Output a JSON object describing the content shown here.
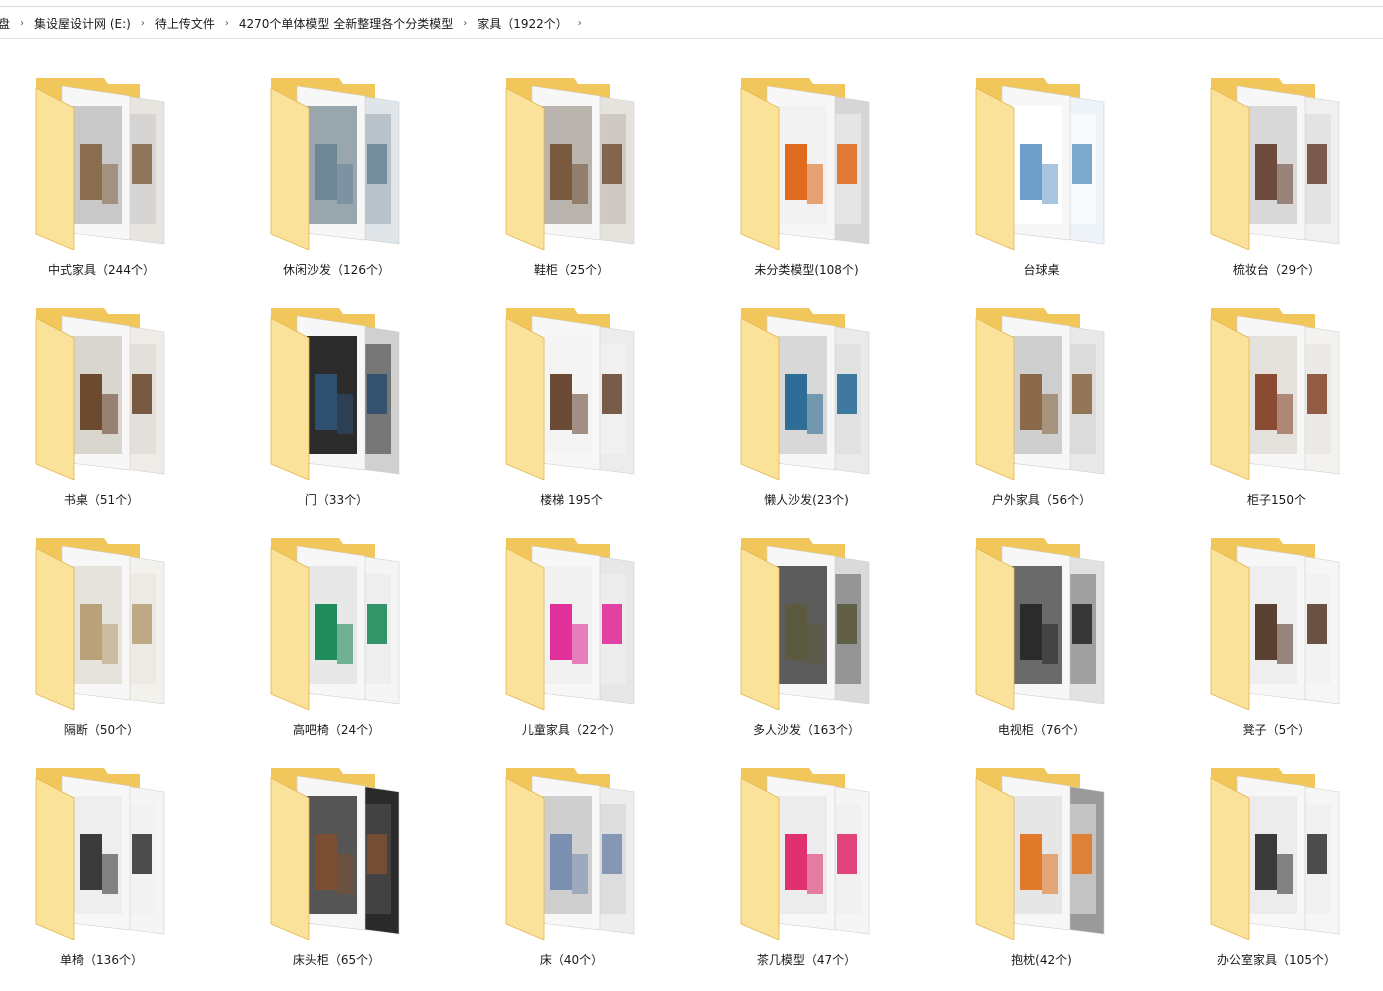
{
  "breadcrumb": [
    "盘",
    "集设屋设计网 (E:)",
    "待上传文件",
    "4270个单体模型 全新整理各个分类模型",
    "家具（1922个）"
  ],
  "folders": [
    {
      "label": "中式家具（244个）",
      "icon": "folder-icon",
      "theme": [
        "#c9c9c9",
        "#8a6c4e",
        "#e8e4df"
      ]
    },
    {
      "label": "休闲沙发（126个）",
      "icon": "folder-icon",
      "theme": [
        "#9aa6ae",
        "#6d8797",
        "#dfe5e8"
      ]
    },
    {
      "label": "鞋柜（25个）",
      "icon": "folder-icon",
      "theme": [
        "#b9b5ae",
        "#7a5a3f",
        "#e6e3de"
      ]
    },
    {
      "label": "未分类模型(108个)",
      "icon": "folder-icon",
      "theme": [
        "#f2f2f2",
        "#e06b1f",
        "#d6d6d6"
      ]
    },
    {
      "label": "台球桌",
      "icon": "folder-icon",
      "theme": [
        "#ffffff",
        "#6f9ec9",
        "#eef3f8"
      ]
    },
    {
      "label": "梳妆台（29个）",
      "icon": "folder-icon",
      "theme": [
        "#d8d8d8",
        "#6e4a3c",
        "#f0f0f0"
      ]
    },
    {
      "label": "书桌（51个）",
      "icon": "folder-icon",
      "theme": [
        "#d9d5cf",
        "#6b4a30",
        "#efece8"
      ]
    },
    {
      "label": "门（33个）",
      "icon": "folder-icon",
      "theme": [
        "#2b2b2b",
        "#2f4f6e",
        "#d0d0d0"
      ]
    },
    {
      "label": "楼梯 195个",
      "icon": "folder-icon",
      "theme": [
        "#f4f4f4",
        "#6b4a36",
        "#ececec"
      ]
    },
    {
      "label": "懒人沙发(23个)",
      "icon": "folder-icon",
      "theme": [
        "#d8d8d8",
        "#2e6e96",
        "#eaeaea"
      ]
    },
    {
      "label": "户外家具（56个）",
      "icon": "folder-icon",
      "theme": [
        "#cfcfcf",
        "#8a6a48",
        "#e9e9e9"
      ]
    },
    {
      "label": "柜子150个",
      "icon": "folder-icon",
      "theme": [
        "#e4e1dc",
        "#8a4b32",
        "#f4f2ef"
      ]
    },
    {
      "label": "隔断（50个）",
      "icon": "folder-icon",
      "theme": [
        "#e6e3dd",
        "#b9a27a",
        "#f3f1ec"
      ]
    },
    {
      "label": "高吧椅（24个）",
      "icon": "folder-icon",
      "theme": [
        "#e8e8e8",
        "#1f8a5a",
        "#f5f5f5"
      ]
    },
    {
      "label": "儿童家具（22个）",
      "icon": "folder-icon",
      "theme": [
        "#f1f1f1",
        "#e0309a",
        "#e7e7e7"
      ]
    },
    {
      "label": "多人沙发（163个）",
      "icon": "folder-icon",
      "theme": [
        "#5c5c5c",
        "#5b5a3e",
        "#dadada"
      ]
    },
    {
      "label": "电视柜（76个）",
      "icon": "folder-icon",
      "theme": [
        "#6a6a6a",
        "#2b2b2b",
        "#e2e2e2"
      ]
    },
    {
      "label": "凳子（5个）",
      "icon": "folder-icon",
      "theme": [
        "#eeeeee",
        "#5a4030",
        "#f6f6f6"
      ]
    },
    {
      "label": "单椅（136个）",
      "icon": "folder-icon",
      "theme": [
        "#eeeeee",
        "#3a3a3a",
        "#f5f5f5"
      ]
    },
    {
      "label": "床头柜（65个）",
      "icon": "folder-icon",
      "theme": [
        "#555555",
        "#7b4f34",
        "#2a2a2a"
      ]
    },
    {
      "label": "床（40个）",
      "icon": "folder-icon",
      "theme": [
        "#cfcfcf",
        "#7b8fb0",
        "#ededed"
      ]
    },
    {
      "label": "茶几模型（47个）",
      "icon": "folder-icon",
      "theme": [
        "#ececec",
        "#e03070",
        "#f5f5f5"
      ]
    },
    {
      "label": "抱枕(42个)",
      "icon": "folder-icon",
      "theme": [
        "#e6e6e6",
        "#e07a2a",
        "#9a9a9a"
      ]
    },
    {
      "label": "办公室家具（105个）",
      "icon": "folder-icon",
      "theme": [
        "#ececec",
        "#3a3a3a",
        "#f6f6f6"
      ]
    }
  ],
  "colors": {
    "folder_back": "#f1c75c",
    "folder_front": "#fbe29a",
    "folder_edge": "#e3b64c"
  }
}
